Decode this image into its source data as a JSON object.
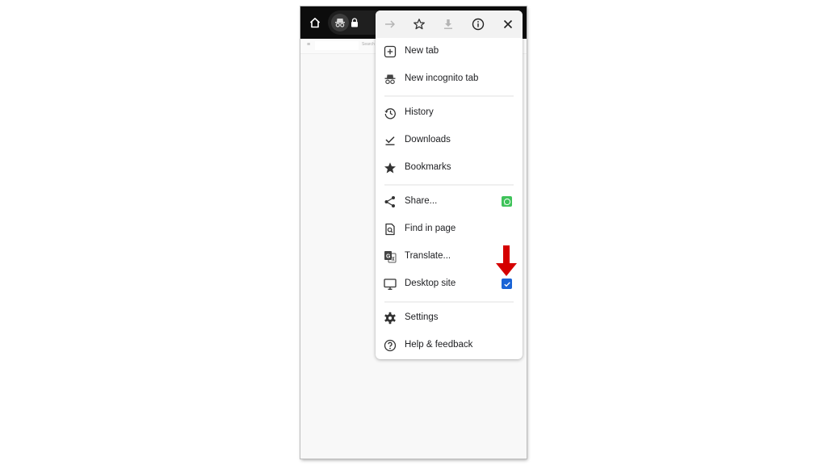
{
  "browser": {
    "topbar": {
      "home_icon": "home-icon",
      "incognito_icon": "incognito-icon",
      "lock_icon": "lock-icon"
    },
    "page": {
      "hamburger_glyph": "≡",
      "search_label": "Search"
    }
  },
  "menu": {
    "toolbar": [
      {
        "name": "forward",
        "icon": "arrow-right-icon",
        "enabled": false
      },
      {
        "name": "bookmark",
        "icon": "star-outline-icon",
        "enabled": true
      },
      {
        "name": "download",
        "icon": "download-icon",
        "enabled": false
      },
      {
        "name": "page-info",
        "icon": "info-icon",
        "enabled": true
      },
      {
        "name": "stop",
        "icon": "close-icon",
        "enabled": true
      }
    ],
    "items": [
      {
        "label": "New tab",
        "icon": "new-tab-icon"
      },
      {
        "label": "New incognito tab",
        "icon": "incognito-icon"
      },
      {
        "label": "History",
        "icon": "history-icon"
      },
      {
        "label": "Downloads",
        "icon": "downloads-icon"
      },
      {
        "label": "Bookmarks",
        "icon": "star-icon"
      },
      {
        "label": "Share...",
        "icon": "share-icon",
        "trailing": "whatsapp-icon"
      },
      {
        "label": "Find in page",
        "icon": "find-in-page-icon"
      },
      {
        "label": "Translate...",
        "icon": "translate-icon"
      },
      {
        "label": "Desktop site",
        "icon": "monitor-icon",
        "checked": true
      },
      {
        "label": "Settings",
        "icon": "gear-icon"
      },
      {
        "label": "Help & feedback",
        "icon": "help-icon"
      }
    ]
  },
  "annotation": {
    "icon": "red-arrow-down-icon",
    "color": "#d50000",
    "target": "Desktop site checkbox"
  },
  "colors": {
    "checkbox": "#1a64d6",
    "whatsapp": "#3fc35a",
    "toolbar_bg": "#f2f2f2",
    "topbar_bg": "#0c0c0c"
  }
}
